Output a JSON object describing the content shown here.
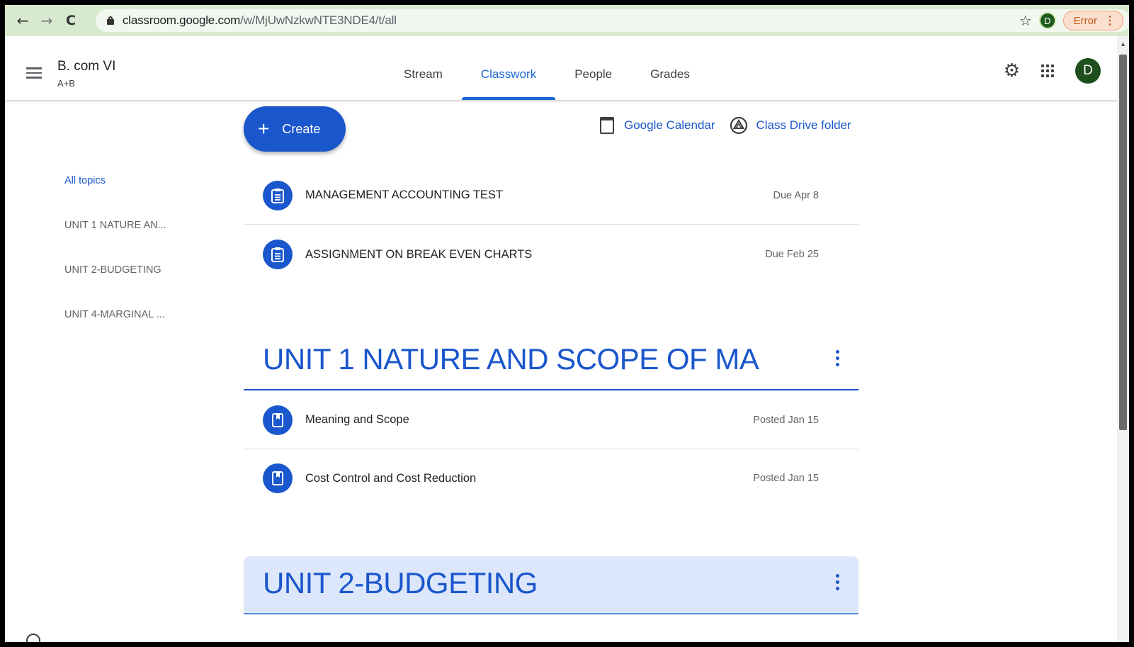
{
  "browser": {
    "url_host": "classroom.google.com",
    "url_path": "/w/MjUwNzkwNTE3NDE4/t/all",
    "profile_initial": "D",
    "error_label": "Error"
  },
  "header": {
    "class_name": "B. com VI",
    "section": "A+B",
    "tabs": [
      {
        "label": "Stream"
      },
      {
        "label": "Classwork"
      },
      {
        "label": "People"
      },
      {
        "label": "Grades"
      }
    ],
    "active_tab": "Classwork",
    "avatar_initial": "D"
  },
  "toolbar": {
    "create_label": "Create",
    "calendar_label": "Google Calendar",
    "drive_label": "Class Drive folder"
  },
  "topics_nav": [
    {
      "label": "All topics"
    },
    {
      "label": "UNIT 1 NATURE AN..."
    },
    {
      "label": "UNIT 2-BUDGETING"
    },
    {
      "label": "UNIT 4-MARGINAL ..."
    }
  ],
  "no_topic_items": [
    {
      "title": "MANAGEMENT ACCOUNTING TEST",
      "date": "Due Apr 8",
      "type": "assignment"
    },
    {
      "title": "ASSIGNMENT ON BREAK EVEN CHARTS",
      "date": "Due Feb 25",
      "type": "assignment"
    }
  ],
  "topic_sections": [
    {
      "title": "UNIT 1 NATURE AND SCOPE OF MA",
      "items": [
        {
          "title": "Meaning and Scope",
          "date": "Posted Jan 15",
          "type": "material"
        },
        {
          "title": "Cost Control and Cost Reduction",
          "date": "Posted Jan 15",
          "type": "material"
        }
      ]
    },
    {
      "title": "UNIT 2-BUDGETING",
      "items": []
    }
  ],
  "colors": {
    "accent": "#1a56cc",
    "chrome_bg": "#d7ead0",
    "topic_highlight": "#dce7fb"
  }
}
